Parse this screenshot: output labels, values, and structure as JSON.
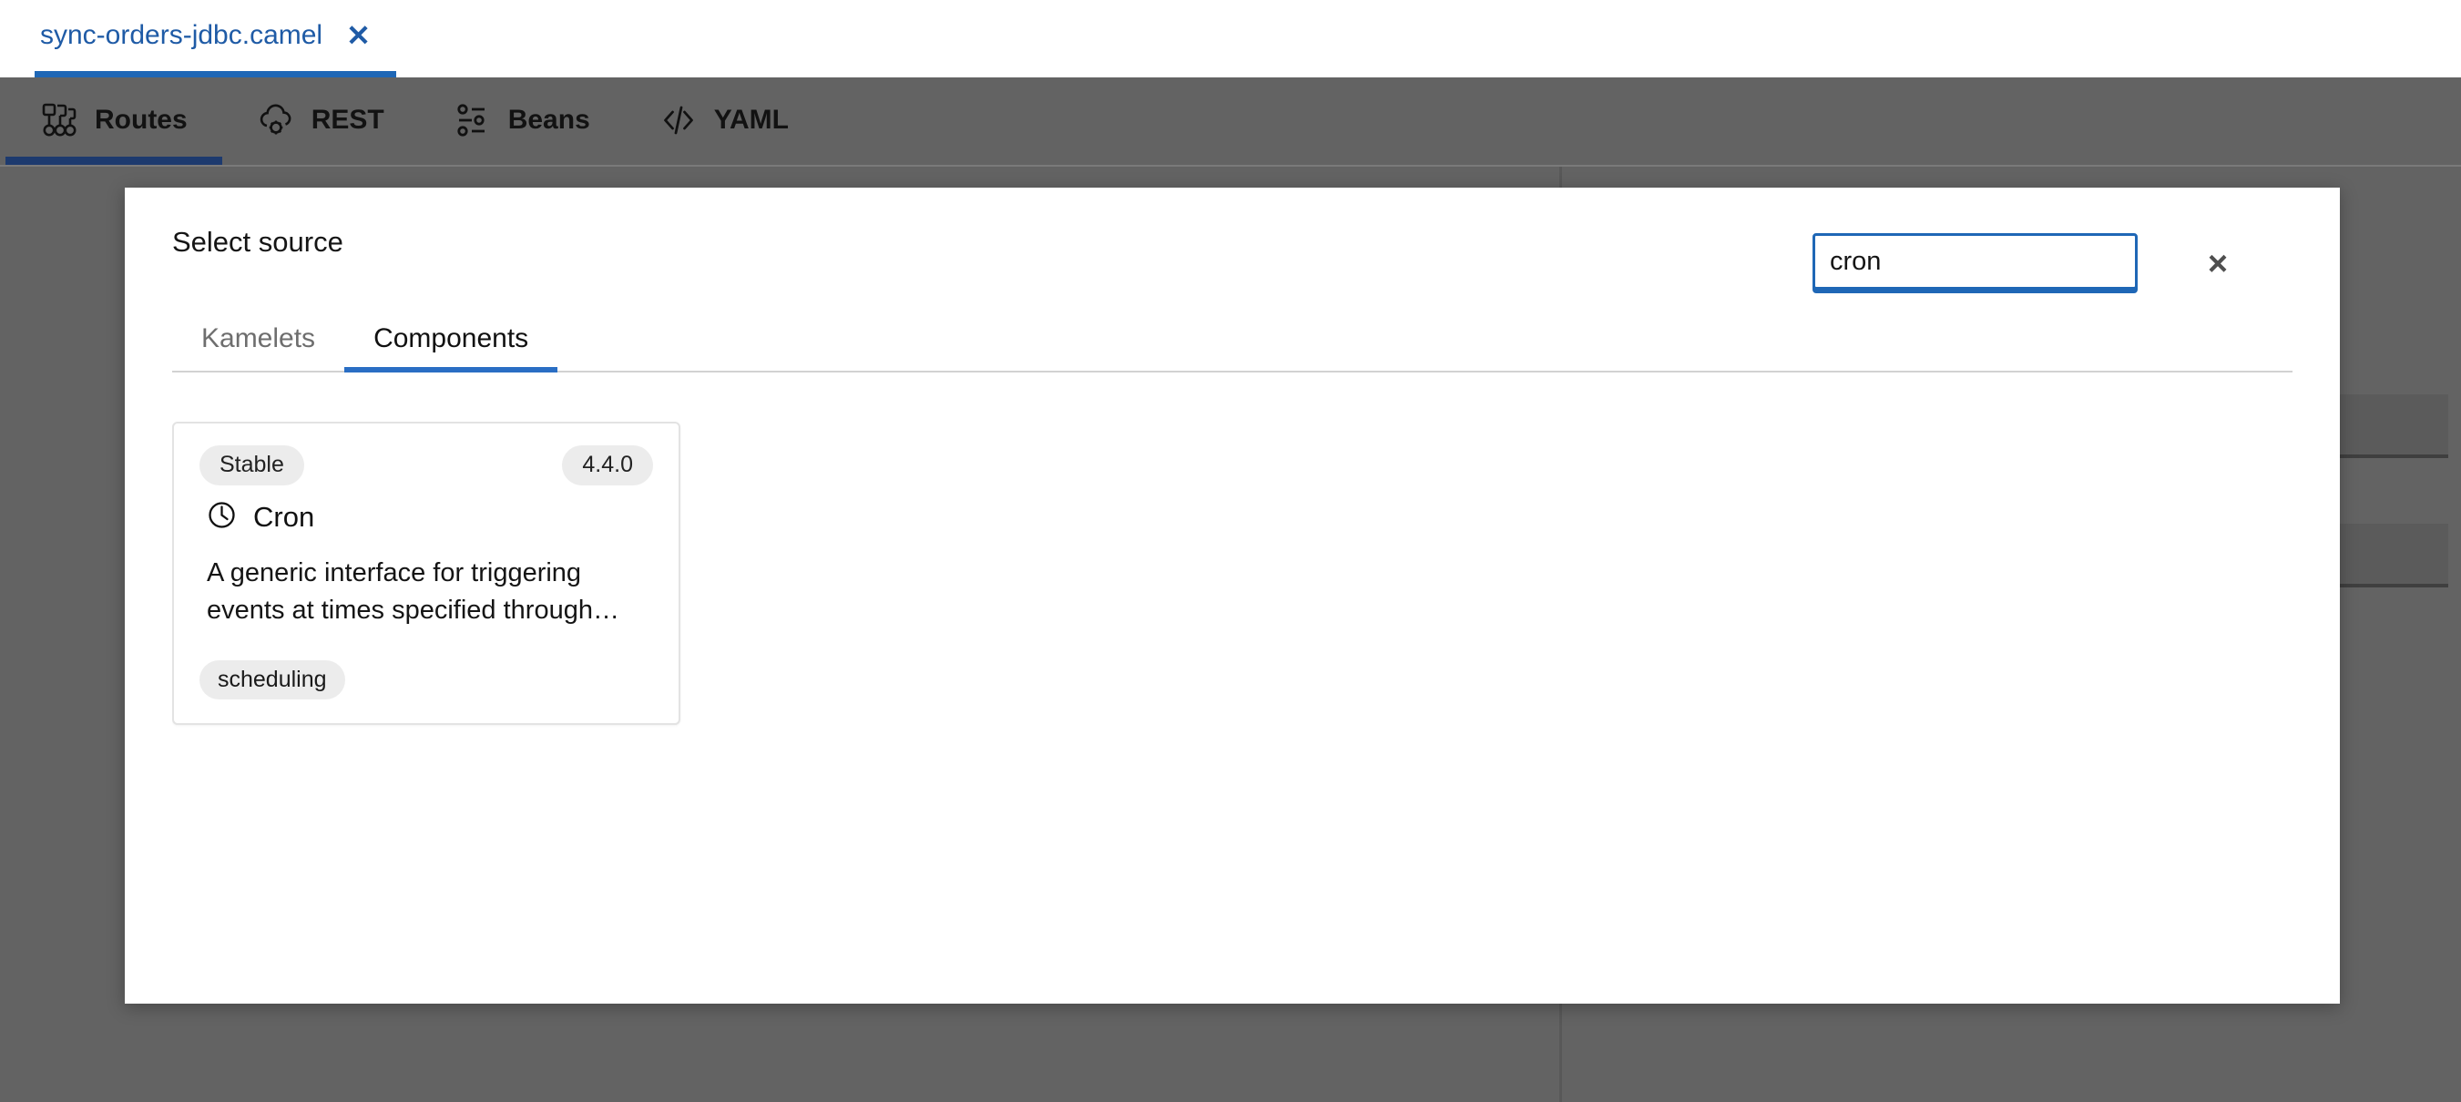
{
  "file_tab": {
    "label": "sync-orders-jdbc.camel",
    "close_icon": "close-icon",
    "accent_color": "#1f67b6"
  },
  "nav": {
    "tabs": [
      {
        "label": "Routes",
        "icon": "routes-graph-icon",
        "active": true
      },
      {
        "label": "REST",
        "icon": "cloud-gear-icon",
        "active": false
      },
      {
        "label": "Beans",
        "icon": "sliders-icon",
        "active": false
      },
      {
        "label": "YAML",
        "icon": "code-brackets-icon",
        "active": false
      }
    ],
    "active_indicator_color": "#1d3a6e",
    "background_color": "#636363"
  },
  "modal": {
    "title": "Select source",
    "close_label": "×",
    "search": {
      "value": "cron",
      "placeholder": "Search",
      "focus_color": "#1f67b6"
    },
    "tabs": [
      {
        "label": "Kamelets",
        "active": false
      },
      {
        "label": "Components",
        "active": true
      }
    ],
    "tab_accent_color": "#2a6ec4",
    "results": [
      {
        "support_level": "Stable",
        "version": "4.4.0",
        "name": "Cron",
        "icon": "clock-icon",
        "description": "A generic interface for triggering events at times specified through…",
        "tags": [
          "scheduling"
        ]
      }
    ]
  }
}
